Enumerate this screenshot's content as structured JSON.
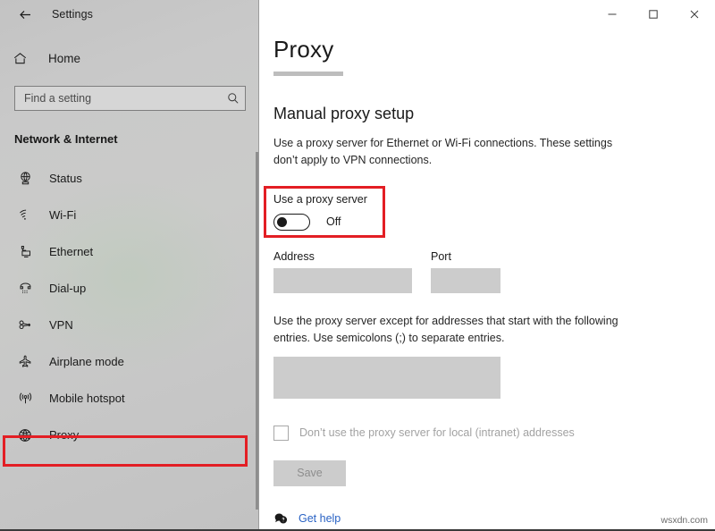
{
  "window": {
    "titlebar_label": "Settings",
    "back_icon": "back-arrow-icon",
    "controls": {
      "minimize": "minimize-icon",
      "maximize": "maximize-icon",
      "close": "close-icon"
    }
  },
  "sidebar": {
    "home_label": "Home",
    "home_icon": "home-icon",
    "search": {
      "placeholder": "Find a setting",
      "value": "",
      "icon": "search-icon"
    },
    "section_heading": "Network & Internet",
    "items": [
      {
        "label": "Status",
        "icon": "globe-monitor-icon"
      },
      {
        "label": "Wi-Fi",
        "icon": "wifi-icon"
      },
      {
        "label": "Ethernet",
        "icon": "ethernet-icon"
      },
      {
        "label": "Dial-up",
        "icon": "dialup-phone-icon"
      },
      {
        "label": "VPN",
        "icon": "vpn-key-icon"
      },
      {
        "label": "Airplane mode",
        "icon": "airplane-icon"
      },
      {
        "label": "Mobile hotspot",
        "icon": "hotspot-icon"
      },
      {
        "label": "Proxy",
        "icon": "globe-icon"
      }
    ],
    "selected_item": "Proxy",
    "highlight_color": "#e31e24"
  },
  "main": {
    "page_title": "Proxy",
    "section_title": "Manual proxy setup",
    "description": "Use a proxy server for Ethernet or Wi-Fi connections. These settings don’t apply to VPN connections.",
    "proxy_toggle": {
      "label": "Use a proxy server",
      "state": "Off",
      "checked": false,
      "highlighted": true
    },
    "address_field": {
      "label": "Address",
      "value": ""
    },
    "port_field": {
      "label": "Port",
      "value": ""
    },
    "exceptions": {
      "description": "Use the proxy server except for addresses that start with the following entries. Use semicolons (;) to separate entries.",
      "value": ""
    },
    "local_bypass": {
      "label": "Don’t use the proxy server for local (intranet) addresses",
      "checked": false
    },
    "save_label": "Save",
    "get_help": {
      "label": "Get help",
      "icon": "help-bubble-icon",
      "color": "#2962c4"
    }
  },
  "watermark": "wsxdn.com"
}
